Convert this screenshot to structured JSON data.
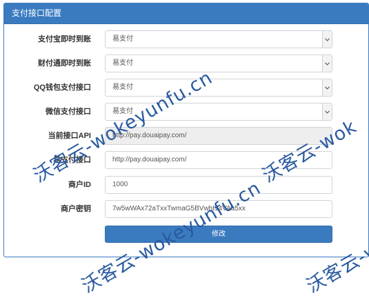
{
  "panel": {
    "title": "支付接口配置"
  },
  "fields": [
    {
      "label": "支付宝即时到账",
      "value": "易支付",
      "type": "select"
    },
    {
      "label": "财付通即时到账",
      "value": "易支付",
      "type": "select"
    },
    {
      "label": "QQ钱包支付接口",
      "value": "易支付",
      "type": "select"
    },
    {
      "label": "微信支付接口",
      "value": "易支付",
      "type": "select"
    },
    {
      "label": "当前接口API",
      "value": "http://pay.douaipay.com/",
      "type": "readonly"
    },
    {
      "label": "易支付接口",
      "value": "http://pay.douaipay.com/",
      "type": "input"
    },
    {
      "label": "商户ID",
      "value": "1000",
      "type": "input"
    },
    {
      "label": "商户密钥",
      "value": "7w5wWAx72aTxxTwmaG5BVwht14VAa5xx",
      "type": "input"
    }
  ],
  "submit_label": "修改",
  "watermarks": [
    "沃客云-wokeyunfu.cn",
    "沃客云-wok",
    "沃客云-wokeyunfu.cn",
    "沃客云-wokeyunfu.cn"
  ],
  "colors": {
    "primary": "#3a7bc0",
    "watermark": "#2a5a9f"
  }
}
